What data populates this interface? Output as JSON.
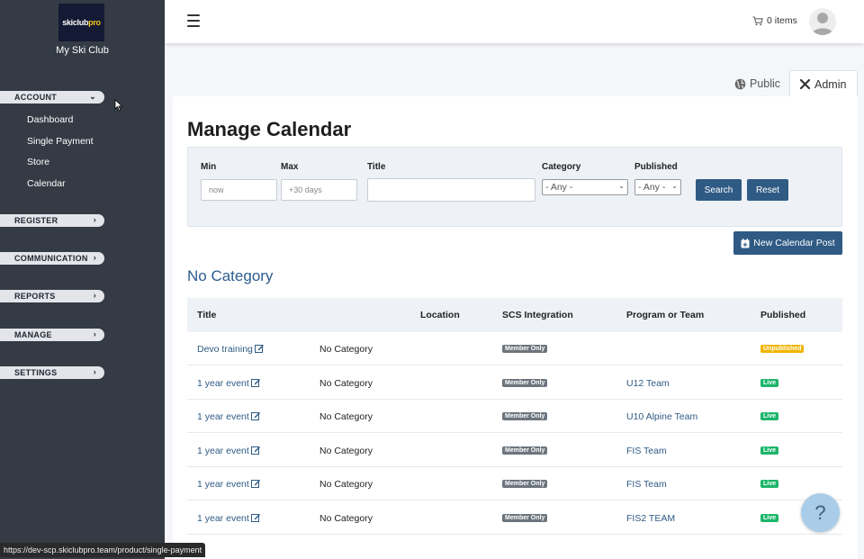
{
  "sidebar": {
    "logo_text": "skiclubpro",
    "logo_part1": "skiclub",
    "logo_part2": "pro",
    "club_name": "My Ski Club",
    "sections": [
      {
        "label": "ACCOUNT",
        "items": [
          "Dashboard",
          "Single Payment",
          "Store",
          "Calendar"
        ]
      },
      {
        "label": "REGISTER"
      },
      {
        "label": "COMMUNICATION"
      },
      {
        "label": "REPORTS"
      },
      {
        "label": "MANAGE"
      },
      {
        "label": "SETTINGS"
      }
    ]
  },
  "header": {
    "cart_label": "0 items",
    "menu_icon": "hamburger-icon",
    "cart_icon": "cart-icon"
  },
  "tabs": [
    {
      "label": "Public",
      "icon": "globe-icon"
    },
    {
      "label": "Admin",
      "icon": "tools-icon",
      "active": true
    }
  ],
  "page": {
    "title": "Manage Calendar",
    "category_heading": "No Category",
    "new_post_label": "New Calendar Post"
  },
  "filters": {
    "min_label": "Min",
    "min_placeholder": "now",
    "max_label": "Max",
    "max_placeholder": "+30 days",
    "title_label": "Title",
    "title_value": "",
    "category_label": "Category",
    "category_value": "- Any -",
    "published_label": "Published",
    "published_value": "- Any -",
    "search_label": "Search",
    "reset_label": "Reset"
  },
  "table": {
    "headers": [
      "Title",
      "Location",
      "SCS Integration",
      "Program or Team",
      "Published"
    ],
    "rows": [
      {
        "title": "Devo training",
        "category": "No Category",
        "scs": "Member Only",
        "program": "",
        "published": "Unpublished"
      },
      {
        "title": "1 year event",
        "category": "No Category",
        "scs": "Member Only",
        "program": "U12 Team",
        "published": "Live"
      },
      {
        "title": "1 year event",
        "category": "No Category",
        "scs": "Member Only",
        "program": "U10 Alpine Team",
        "published": "Live"
      },
      {
        "title": "1 year event",
        "category": "No Category",
        "scs": "Member Only",
        "program": "FIS Team",
        "published": "Live"
      },
      {
        "title": "1 year event",
        "category": "No Category",
        "scs": "Member Only",
        "program": "FIS Team",
        "published": "Live"
      },
      {
        "title": "1 year event",
        "category": "No Category",
        "scs": "Member Only",
        "program": "FIS2 TEAM",
        "published": "Live"
      }
    ]
  },
  "help_label": "?",
  "status_url": "https://dev-scp.skiclubpro.team/product/single-payment",
  "colors": {
    "sidebar_bg": "#343b45",
    "primary": "#2f5a84",
    "live": "#1cb56a",
    "unpublished": "#f0b400",
    "member_only": "#6c757d"
  }
}
